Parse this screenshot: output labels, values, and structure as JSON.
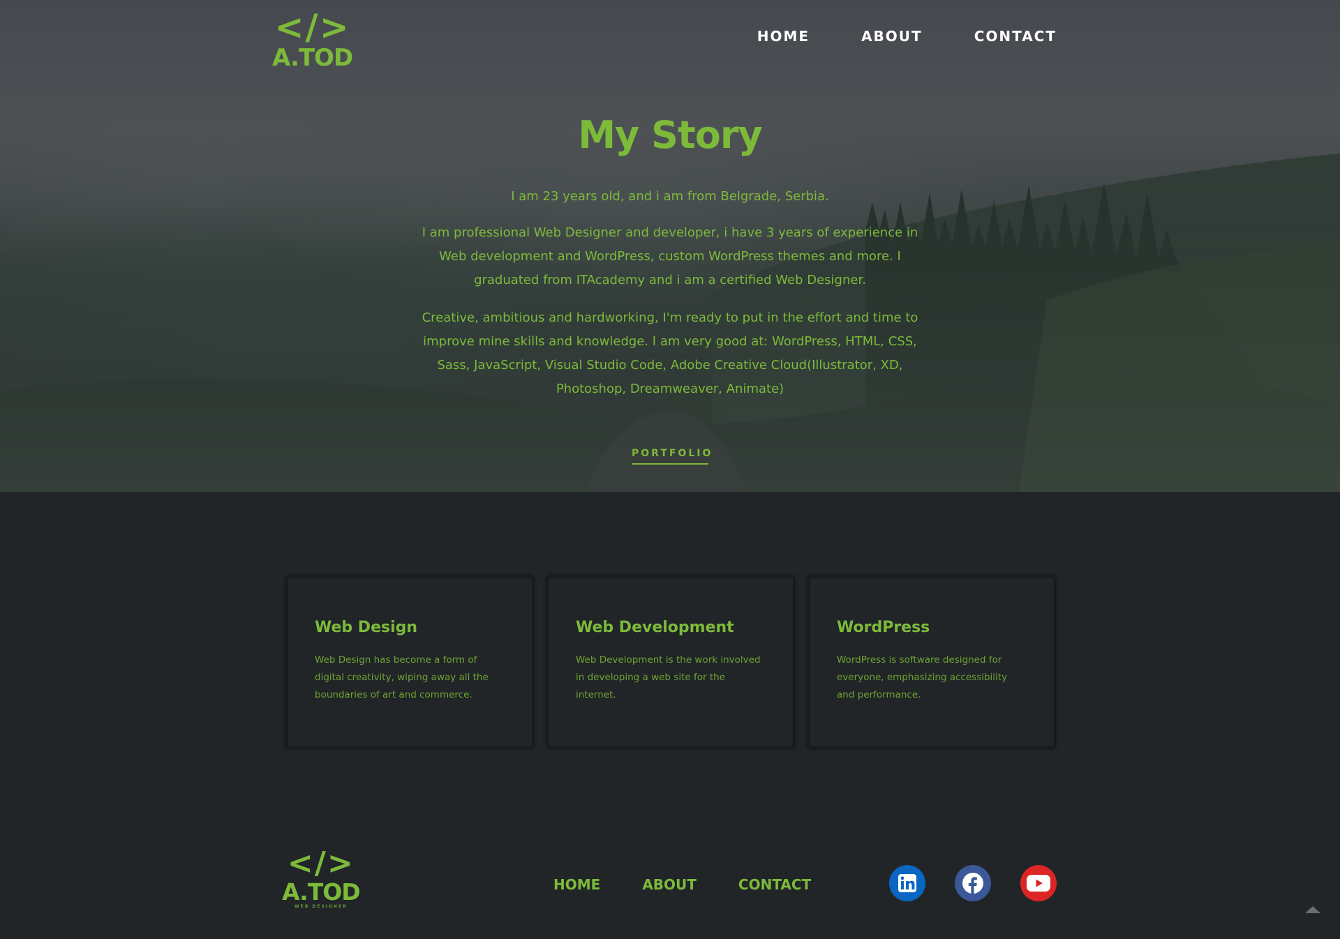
{
  "brand": {
    "logo_code": "</>",
    "logo_text": "A.TOD",
    "logo_sub": "WEB DESIGNER"
  },
  "header": {
    "nav": [
      "HOME",
      "ABOUT",
      "CONTACT"
    ]
  },
  "story": {
    "title": "My Story",
    "paragraphs": [
      "I am 23 years old, and i am from Belgrade, Serbia.",
      "I am professional Web Designer and developer, i have 3 years of experience in Web development and WordPress, custom WordPress themes and more. I graduated from ITAcademy and i am a certified Web Designer.",
      "Creative, ambitious and hardworking, I'm ready to put in the effort and time to improve mine skills and knowledge. I am very good at: WordPress, HTML, CSS, Sass, JavaScript, Visual Studio Code, Adobe Creative Cloud(Illustrator, XD, Photoshop, Dreamweaver, Animate)"
    ],
    "cta": "PORTFOLIO"
  },
  "services": [
    {
      "title": "Web Design",
      "text": "Web Design has become a form of digital creativity, wiping away all the boundaries of art and commerce."
    },
    {
      "title": "Web Development",
      "text": "Web Development is the work involved in developing a web site for the internet."
    },
    {
      "title": "WordPress",
      "text": "WordPress is software designed for everyone, emphasizing accessibility and performance."
    }
  ],
  "footer": {
    "nav": [
      "HOME",
      "ABOUT",
      "CONTACT"
    ],
    "socials": [
      {
        "name": "LinkedIn",
        "icon": "linkedin-icon",
        "color": "#0a66c2"
      },
      {
        "name": "Facebook",
        "icon": "facebook-icon",
        "color": "#3b5998"
      },
      {
        "name": "YouTube",
        "icon": "youtube-icon",
        "color": "#dc2626"
      }
    ],
    "to_top_icon": "triangle-up-icon"
  },
  "colors": {
    "accent": "#7dba3a",
    "background": "#212528",
    "nav_text": "#ffffff"
  }
}
